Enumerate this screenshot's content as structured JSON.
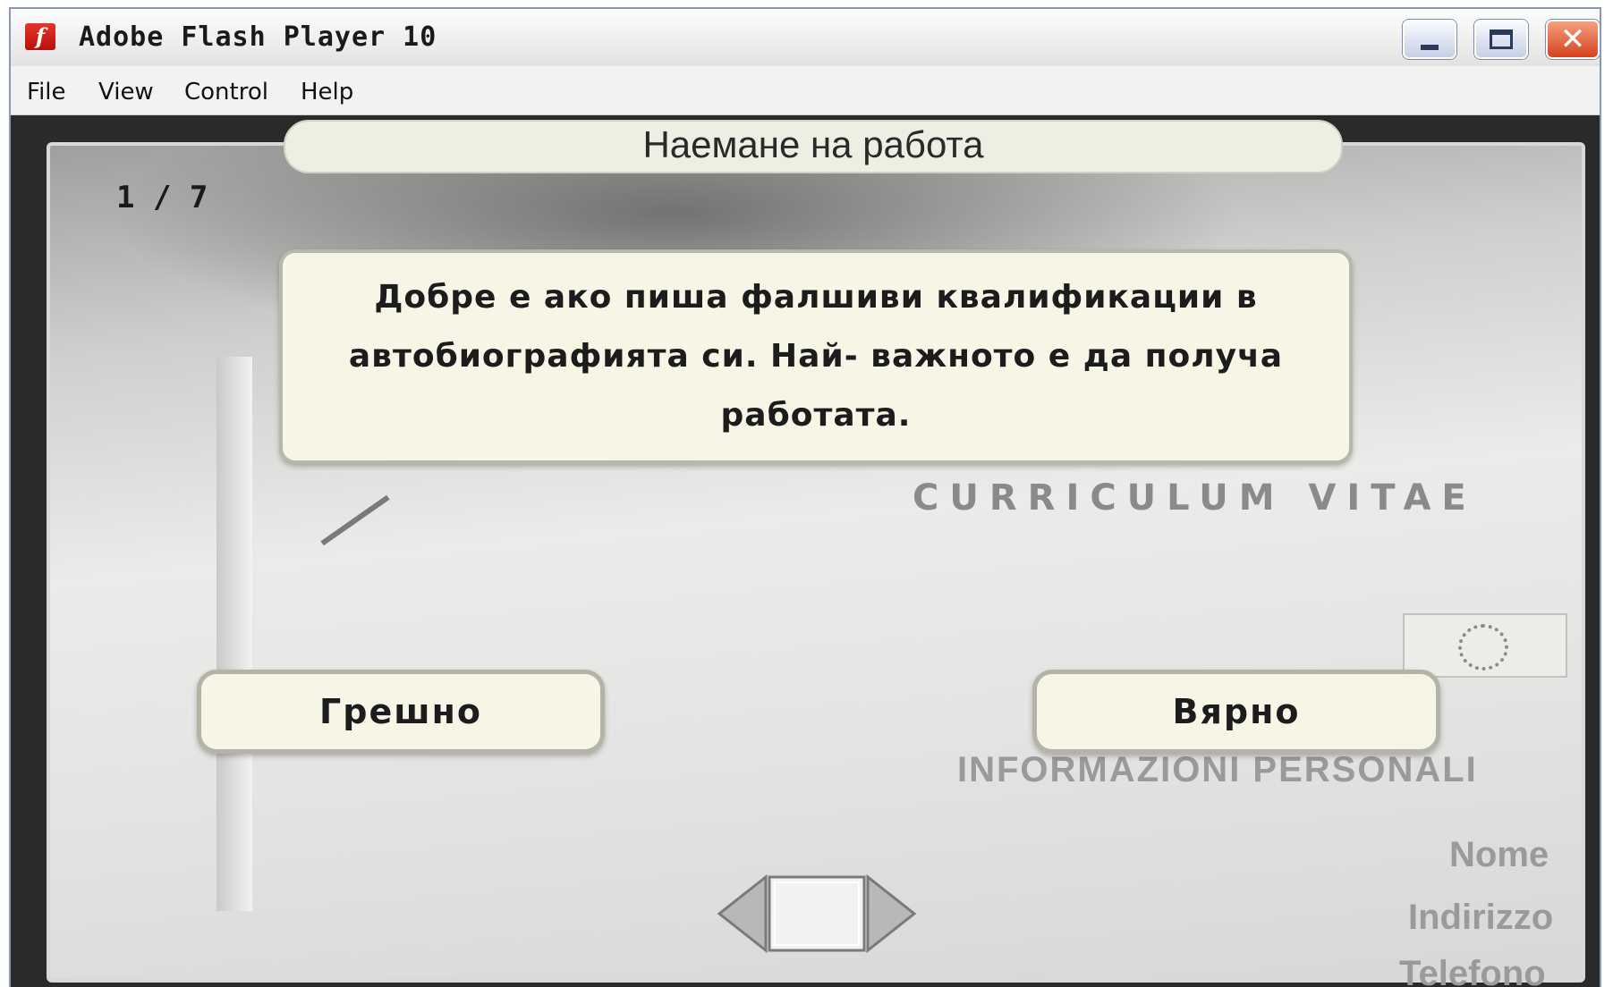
{
  "window": {
    "title": "Adobe Flash Player 10",
    "icon": "flash-player-icon"
  },
  "menubar": {
    "items": [
      "File",
      "View",
      "Control",
      "Help"
    ]
  },
  "quiz": {
    "counter": "1 / 7",
    "topic": "Наемане на работа",
    "question": "Добре е ако пиша фалшиви квалификации в автобиографията си. Най- важното е да получа работата.",
    "answers": {
      "wrong": "Грешно",
      "right": "Вярно"
    }
  },
  "background_document": {
    "heading": "CURRICULUM VITAE",
    "section": "INFORMAZIONI PERSONALI",
    "fields": [
      "Nome",
      "Indirizzo",
      "Telefono"
    ]
  },
  "colors": {
    "card_fill": "#f6f5e6",
    "card_border": "#b4b4a6",
    "close_button": "#d4421f"
  }
}
